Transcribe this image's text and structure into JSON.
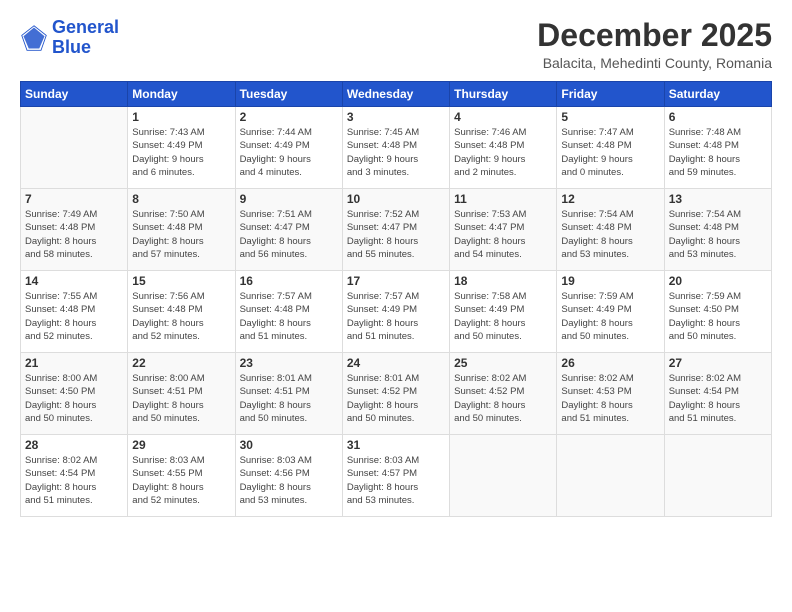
{
  "header": {
    "logo_line1": "General",
    "logo_line2": "Blue",
    "month": "December 2025",
    "location": "Balacita, Mehedinti County, Romania"
  },
  "days_of_week": [
    "Sunday",
    "Monday",
    "Tuesday",
    "Wednesday",
    "Thursday",
    "Friday",
    "Saturday"
  ],
  "weeks": [
    [
      {
        "day": "",
        "info": ""
      },
      {
        "day": "1",
        "info": "Sunrise: 7:43 AM\nSunset: 4:49 PM\nDaylight: 9 hours\nand 6 minutes."
      },
      {
        "day": "2",
        "info": "Sunrise: 7:44 AM\nSunset: 4:49 PM\nDaylight: 9 hours\nand 4 minutes."
      },
      {
        "day": "3",
        "info": "Sunrise: 7:45 AM\nSunset: 4:48 PM\nDaylight: 9 hours\nand 3 minutes."
      },
      {
        "day": "4",
        "info": "Sunrise: 7:46 AM\nSunset: 4:48 PM\nDaylight: 9 hours\nand 2 minutes."
      },
      {
        "day": "5",
        "info": "Sunrise: 7:47 AM\nSunset: 4:48 PM\nDaylight: 9 hours\nand 0 minutes."
      },
      {
        "day": "6",
        "info": "Sunrise: 7:48 AM\nSunset: 4:48 PM\nDaylight: 8 hours\nand 59 minutes."
      }
    ],
    [
      {
        "day": "7",
        "info": "Sunrise: 7:49 AM\nSunset: 4:48 PM\nDaylight: 8 hours\nand 58 minutes."
      },
      {
        "day": "8",
        "info": "Sunrise: 7:50 AM\nSunset: 4:48 PM\nDaylight: 8 hours\nand 57 minutes."
      },
      {
        "day": "9",
        "info": "Sunrise: 7:51 AM\nSunset: 4:47 PM\nDaylight: 8 hours\nand 56 minutes."
      },
      {
        "day": "10",
        "info": "Sunrise: 7:52 AM\nSunset: 4:47 PM\nDaylight: 8 hours\nand 55 minutes."
      },
      {
        "day": "11",
        "info": "Sunrise: 7:53 AM\nSunset: 4:47 PM\nDaylight: 8 hours\nand 54 minutes."
      },
      {
        "day": "12",
        "info": "Sunrise: 7:54 AM\nSunset: 4:48 PM\nDaylight: 8 hours\nand 53 minutes."
      },
      {
        "day": "13",
        "info": "Sunrise: 7:54 AM\nSunset: 4:48 PM\nDaylight: 8 hours\nand 53 minutes."
      }
    ],
    [
      {
        "day": "14",
        "info": "Sunrise: 7:55 AM\nSunset: 4:48 PM\nDaylight: 8 hours\nand 52 minutes."
      },
      {
        "day": "15",
        "info": "Sunrise: 7:56 AM\nSunset: 4:48 PM\nDaylight: 8 hours\nand 52 minutes."
      },
      {
        "day": "16",
        "info": "Sunrise: 7:57 AM\nSunset: 4:48 PM\nDaylight: 8 hours\nand 51 minutes."
      },
      {
        "day": "17",
        "info": "Sunrise: 7:57 AM\nSunset: 4:49 PM\nDaylight: 8 hours\nand 51 minutes."
      },
      {
        "day": "18",
        "info": "Sunrise: 7:58 AM\nSunset: 4:49 PM\nDaylight: 8 hours\nand 50 minutes."
      },
      {
        "day": "19",
        "info": "Sunrise: 7:59 AM\nSunset: 4:49 PM\nDaylight: 8 hours\nand 50 minutes."
      },
      {
        "day": "20",
        "info": "Sunrise: 7:59 AM\nSunset: 4:50 PM\nDaylight: 8 hours\nand 50 minutes."
      }
    ],
    [
      {
        "day": "21",
        "info": "Sunrise: 8:00 AM\nSunset: 4:50 PM\nDaylight: 8 hours\nand 50 minutes."
      },
      {
        "day": "22",
        "info": "Sunrise: 8:00 AM\nSunset: 4:51 PM\nDaylight: 8 hours\nand 50 minutes."
      },
      {
        "day": "23",
        "info": "Sunrise: 8:01 AM\nSunset: 4:51 PM\nDaylight: 8 hours\nand 50 minutes."
      },
      {
        "day": "24",
        "info": "Sunrise: 8:01 AM\nSunset: 4:52 PM\nDaylight: 8 hours\nand 50 minutes."
      },
      {
        "day": "25",
        "info": "Sunrise: 8:02 AM\nSunset: 4:52 PM\nDaylight: 8 hours\nand 50 minutes."
      },
      {
        "day": "26",
        "info": "Sunrise: 8:02 AM\nSunset: 4:53 PM\nDaylight: 8 hours\nand 51 minutes."
      },
      {
        "day": "27",
        "info": "Sunrise: 8:02 AM\nSunset: 4:54 PM\nDaylight: 8 hours\nand 51 minutes."
      }
    ],
    [
      {
        "day": "28",
        "info": "Sunrise: 8:02 AM\nSunset: 4:54 PM\nDaylight: 8 hours\nand 51 minutes."
      },
      {
        "day": "29",
        "info": "Sunrise: 8:03 AM\nSunset: 4:55 PM\nDaylight: 8 hours\nand 52 minutes."
      },
      {
        "day": "30",
        "info": "Sunrise: 8:03 AM\nSunset: 4:56 PM\nDaylight: 8 hours\nand 53 minutes."
      },
      {
        "day": "31",
        "info": "Sunrise: 8:03 AM\nSunset: 4:57 PM\nDaylight: 8 hours\nand 53 minutes."
      },
      {
        "day": "",
        "info": ""
      },
      {
        "day": "",
        "info": ""
      },
      {
        "day": "",
        "info": ""
      }
    ]
  ]
}
